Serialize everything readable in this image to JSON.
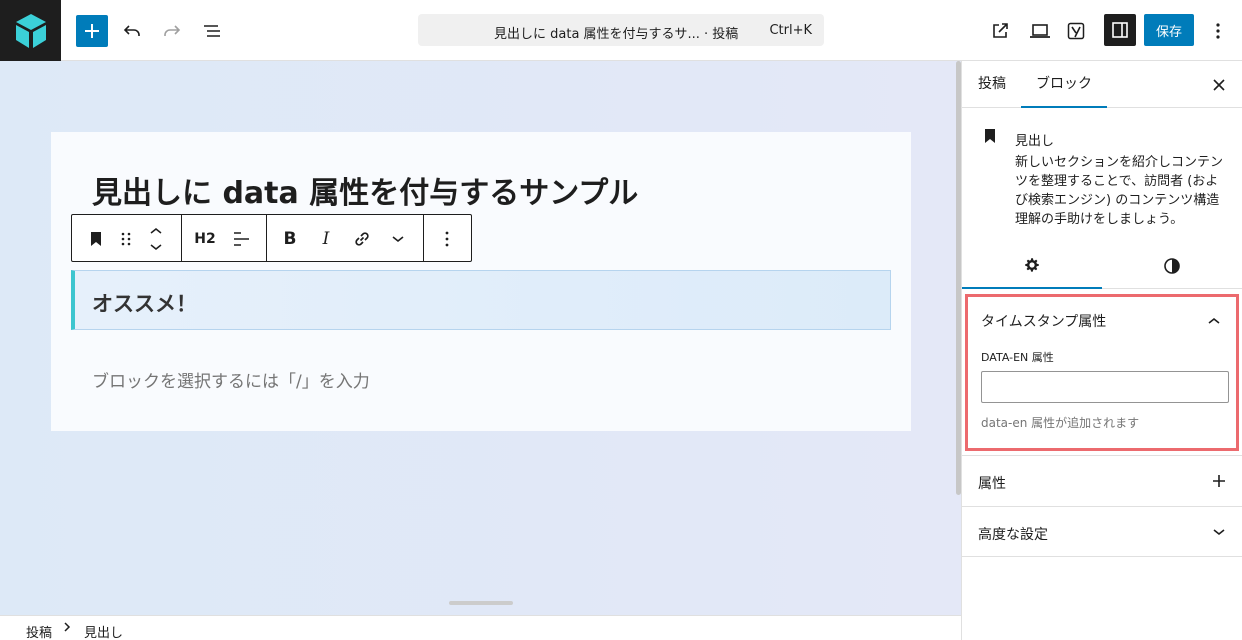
{
  "header": {
    "document_title": "見出しに data 属性を付与するサ...",
    "document_type": "· 投稿",
    "shortcut": "Ctrl+K",
    "save_label": "保存"
  },
  "editor": {
    "post_title": "見出しに data 属性を付与するサンプル",
    "toolbar": {
      "heading_level": "H2",
      "bold": "B",
      "italic": "I"
    },
    "heading_block_text": "オススメ！",
    "empty_block_placeholder": "ブロックを選択するには「/」を入力"
  },
  "breadcrumb": [
    "投稿",
    "見出し"
  ],
  "sidebar": {
    "tabs": [
      "投稿",
      "ブロック"
    ],
    "active_tab": "ブロック",
    "block_card": {
      "name": "見出し",
      "description": "新しいセクションを紹介しコンテンツを整理することで、訪問者 (および検索エンジン) のコンテンツ構造理解の手助けをしましょう。"
    },
    "timestamp_panel": {
      "title": "タイムスタンプ属性",
      "field_label": "DATA-EN 属性",
      "field_value": "",
      "help_text": "data-en 属性が追加されます"
    },
    "attributes_panel": {
      "title": "属性"
    },
    "advanced_panel": {
      "title": "高度な設定"
    }
  },
  "colors": {
    "accent": "#007cba",
    "highlight_border": "#ec6a6e",
    "heading_left_border": "#3cc5cf",
    "logo_teal": "#3bd0d8"
  }
}
